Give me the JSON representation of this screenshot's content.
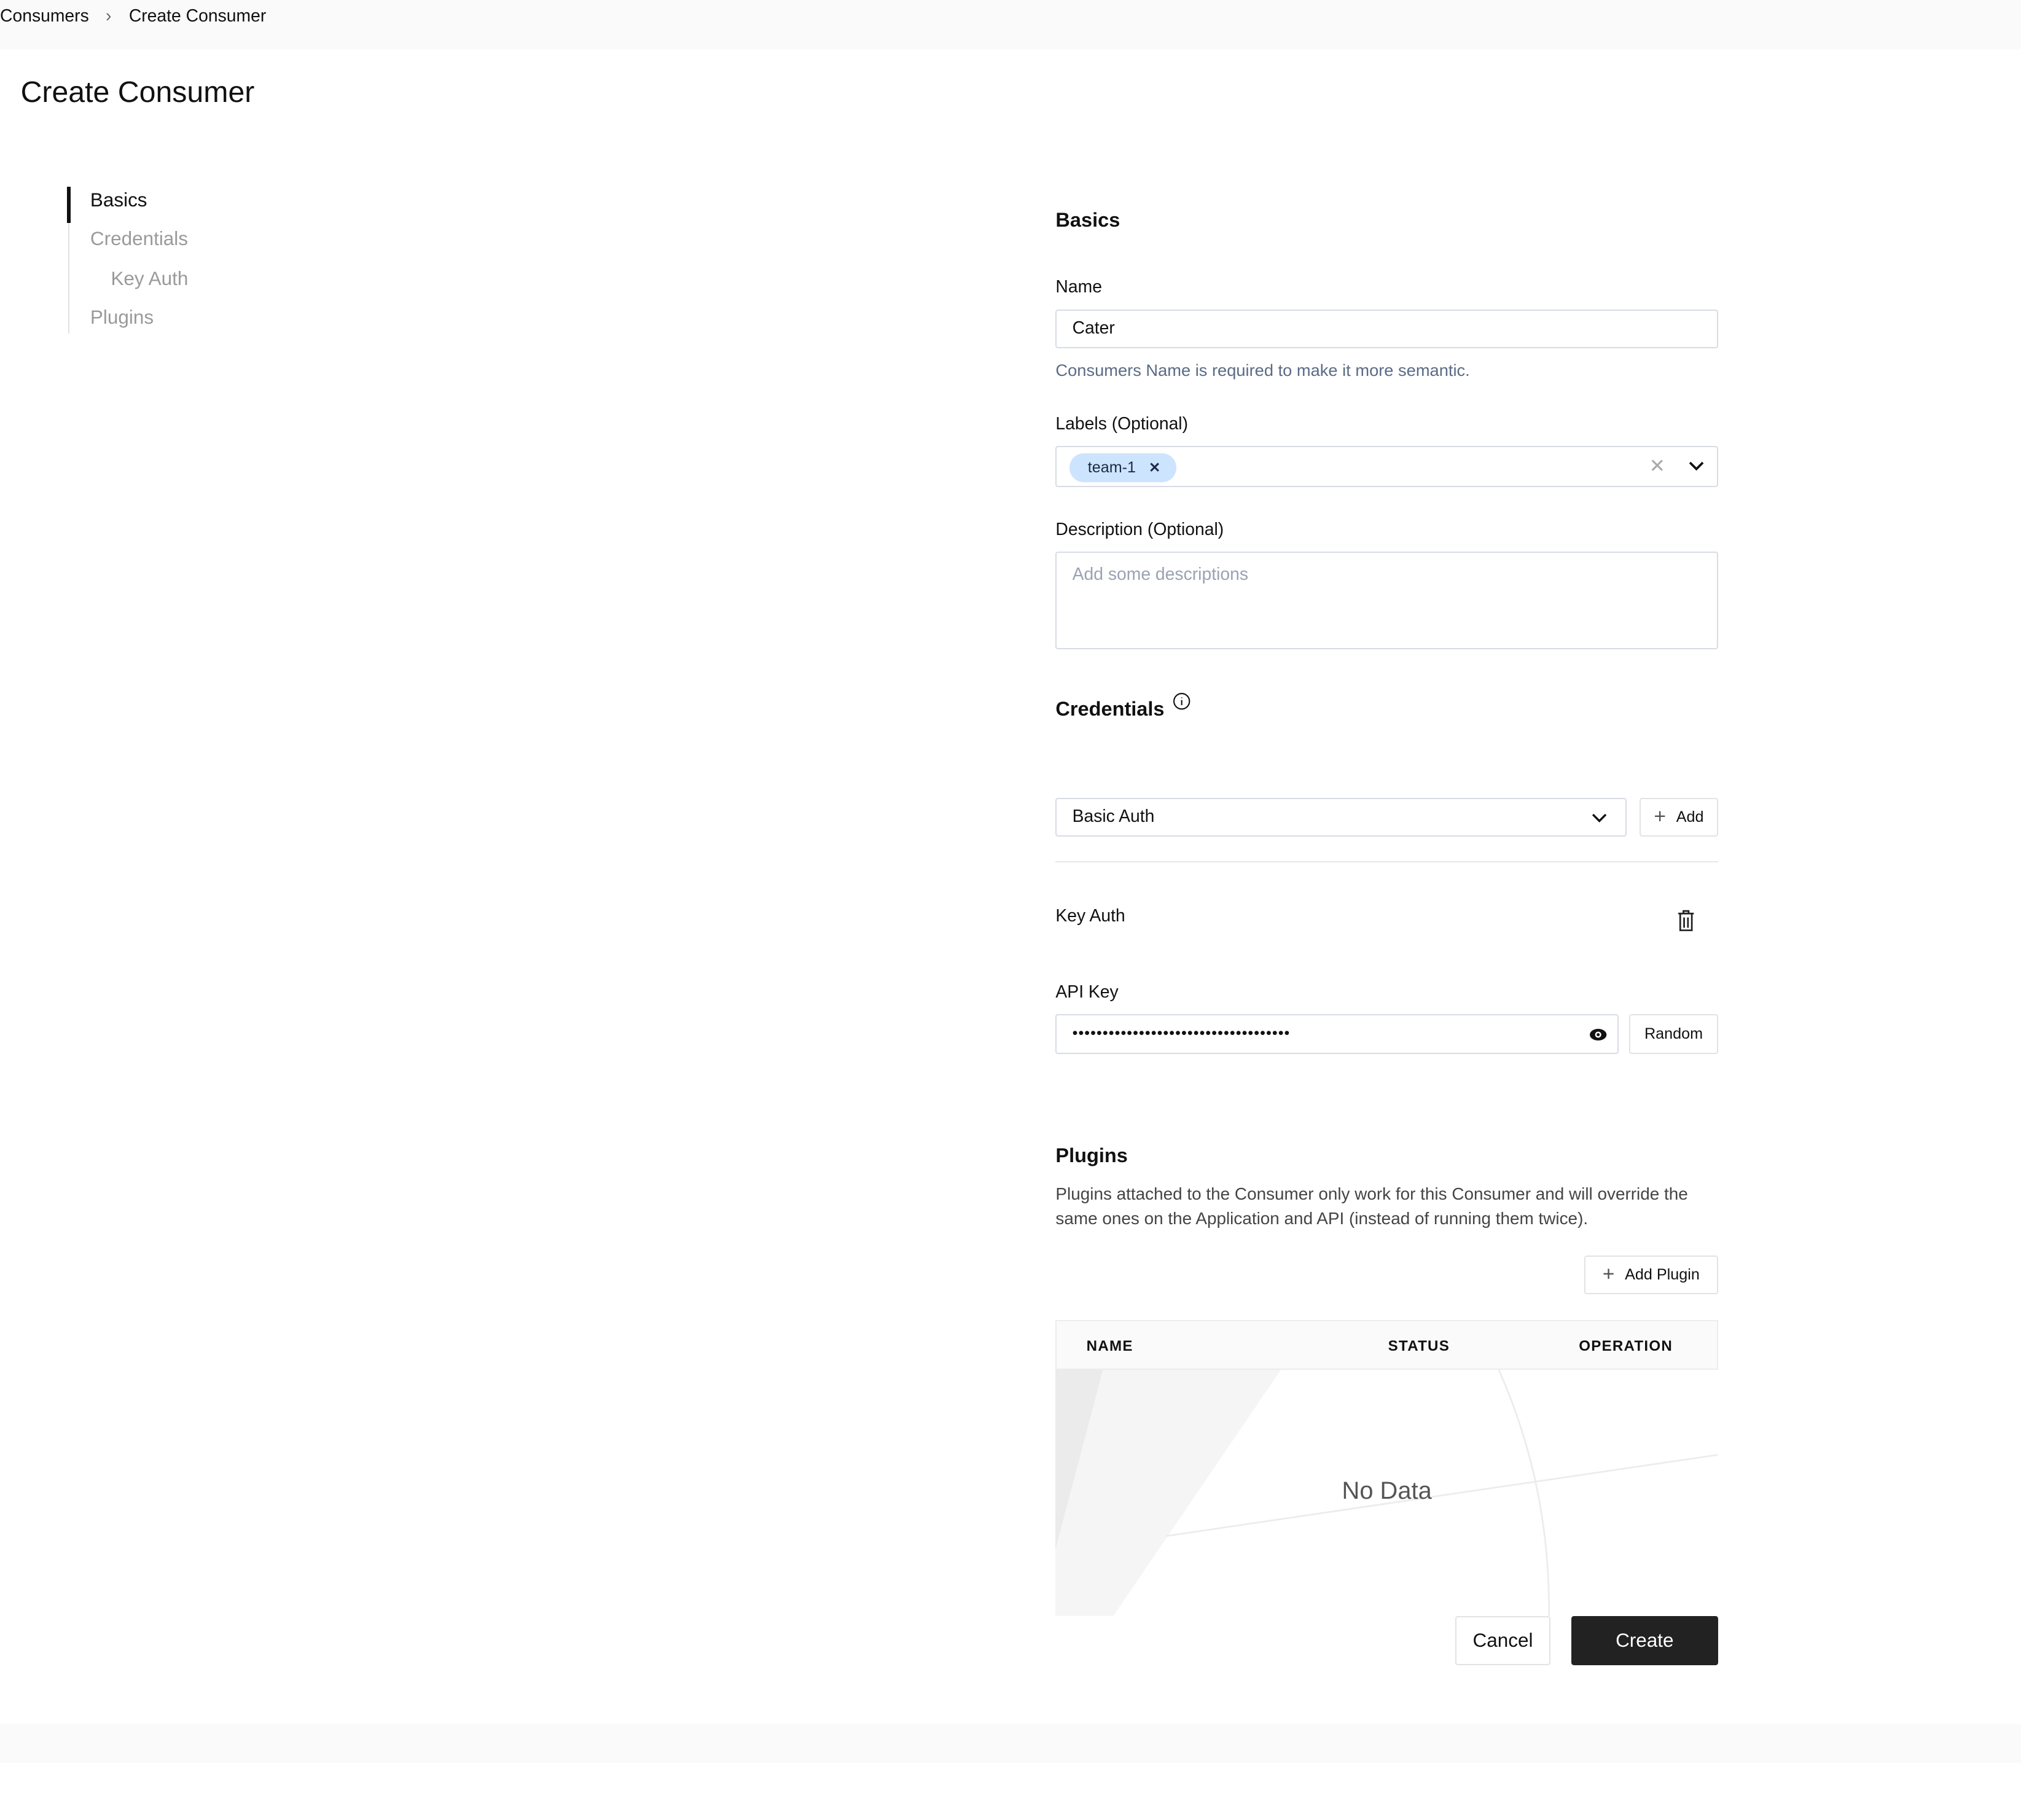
{
  "breadcrumb": {
    "items": [
      "Consumers",
      "Create Consumer"
    ],
    "separator": "›"
  },
  "page_title": "Create Consumer",
  "side_nav": {
    "items": [
      {
        "label": "Basics",
        "active": true
      },
      {
        "label": "Credentials"
      },
      {
        "label": "Key Auth"
      },
      {
        "label": "Plugins"
      }
    ]
  },
  "basics": {
    "heading": "Basics",
    "name_label": "Name",
    "name_value": "Cater",
    "name_help": "Consumers Name is required to make it more semantic.",
    "labels_label": "Labels (Optional)",
    "labels_tags": [
      "team-1"
    ],
    "description_label": "Description (Optional)",
    "description_placeholder": "Add some descriptions"
  },
  "credentials": {
    "heading": "Credentials",
    "info_icon": "info-circle-icon",
    "type_select": "Basic Auth",
    "add_label": "Add",
    "key_auth_title": "Key Auth",
    "api_key_label": "API Key",
    "api_key_value": "••••••••••••••••••••••••••••••••••••",
    "random_label": "Random"
  },
  "plugins": {
    "heading": "Plugins",
    "description": "Plugins attached to the Consumer only work for this Consumer and will override the same ones on the Application and API (instead of running them twice).",
    "add_label": "Add Plugin",
    "columns": [
      "NAME",
      "STATUS",
      "OPERATION"
    ],
    "empty_text": "No Data"
  },
  "actions": {
    "cancel": "Cancel",
    "create": "Create"
  },
  "colors": {
    "primary_button": "#222222",
    "tag_bg": "#cde4ff",
    "help_text": "#5a6b85"
  }
}
